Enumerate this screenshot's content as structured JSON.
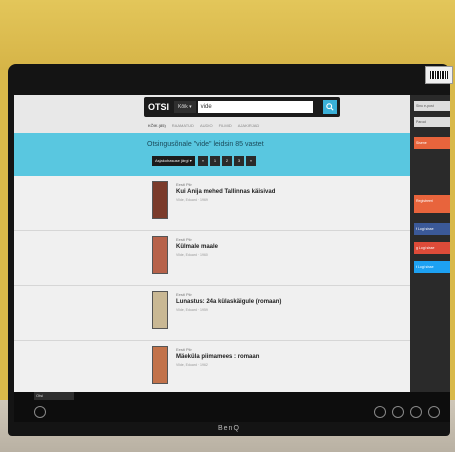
{
  "search": {
    "logo": "OTSI",
    "scope": "Kõik",
    "query": "vide"
  },
  "tabs": [
    "KÕIK (85)",
    "RAAMATUD",
    "AUDIO",
    "FILMID",
    "AJAKIRJAD"
  ],
  "banner": {
    "heading": "Otsingusõnale \"vide\" leidsin 85 vastet",
    "sort_label": "Asjakohasuse järgi",
    "pages": [
      "«",
      "1",
      "2",
      "3",
      "»"
    ]
  },
  "results": [
    {
      "kind": "Eesti Piir",
      "title": "Kui Anija mehed Tallinnas käisivad",
      "meta": "Vilde, Eduard · 1969"
    },
    {
      "kind": "Eesti Piir",
      "title": "Külmale maale",
      "meta": "Vilde, Eduard · 1960"
    },
    {
      "kind": "Eesti Piir",
      "title": "Lunastus: 24a külaskäigule (romaan)",
      "meta": "Vilde, Eduard · 1959"
    },
    {
      "kind": "Eesti Piir",
      "title": "Mäeküla piimamees : romaan",
      "meta": "Vilde, Eduard · 1962"
    }
  ],
  "right_panel": {
    "email_placeholder": "Sinu e-post",
    "password_placeholder": "Parool",
    "login": "Sisene",
    "register": "Registreeri",
    "facebook": "Logi sisse",
    "google": "Logi sisse",
    "twitter": "Logi sisse"
  },
  "taskbar": {
    "tab_label": "Otsi"
  },
  "monitor_brand": "BenQ",
  "colors": {
    "banner": "#59c7e0",
    "search_button": "#3ab0d8",
    "login_button": "#e8643c",
    "facebook": "#3b5998",
    "google": "#dd4b39",
    "twitter": "#1da1f2"
  }
}
